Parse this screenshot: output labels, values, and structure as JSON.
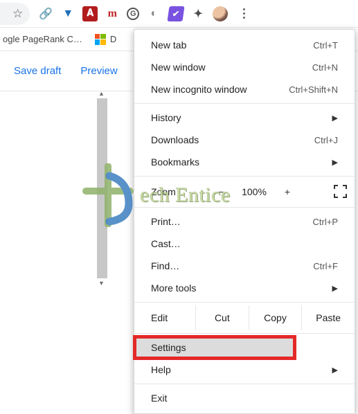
{
  "toolbar": {
    "extensions": [
      {
        "name": "link-icon",
        "glyph": "🔗",
        "color": "#4aa0d8"
      },
      {
        "name": "shield-icon",
        "glyph": "▼",
        "color": "#1e6fb8"
      },
      {
        "name": "adobe-icon",
        "glyph": "A",
        "color": "#fff",
        "bg": "#b11d1d"
      },
      {
        "name": "m-icon",
        "glyph": "m",
        "color": "#c1272d"
      },
      {
        "name": "grammarly-icon",
        "glyph": "G",
        "color": "#555"
      },
      {
        "name": "circle-icon",
        "glyph": "◑",
        "color": "#8a8a8a"
      },
      {
        "name": "check-icon",
        "glyph": "✔",
        "color": "#7a52e0"
      },
      {
        "name": "extensions-icon",
        "glyph": "✦",
        "color": "#4d4d4d"
      }
    ]
  },
  "bookmarks": {
    "item1": "ogle PageRank C…",
    "item2": "D"
  },
  "page": {
    "save_draft": "Save draft",
    "preview": "Preview"
  },
  "menu": {
    "new_tab": {
      "label": "New tab",
      "shortcut": "Ctrl+T"
    },
    "new_window": {
      "label": "New window",
      "shortcut": "Ctrl+N"
    },
    "incognito": {
      "label": "New incognito window",
      "shortcut": "Ctrl+Shift+N"
    },
    "history": {
      "label": "History"
    },
    "downloads": {
      "label": "Downloads",
      "shortcut": "Ctrl+J"
    },
    "bookmarks": {
      "label": "Bookmarks"
    },
    "zoom": {
      "label": "Zoom",
      "minus": "−",
      "value": "100%",
      "plus": "+"
    },
    "print": {
      "label": "Print…",
      "shortcut": "Ctrl+P"
    },
    "cast": {
      "label": "Cast…"
    },
    "find": {
      "label": "Find…",
      "shortcut": "Ctrl+F"
    },
    "more_tools": {
      "label": "More tools"
    },
    "edit": {
      "label": "Edit",
      "cut": "Cut",
      "copy": "Copy",
      "paste": "Paste"
    },
    "settings": {
      "label": "Settings"
    },
    "help": {
      "label": "Help"
    },
    "exit": {
      "label": "Exit"
    }
  },
  "watermark": {
    "text": "ech Entice"
  }
}
